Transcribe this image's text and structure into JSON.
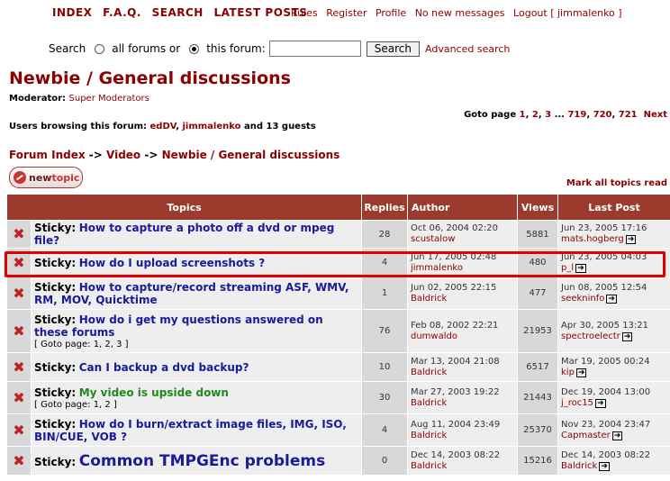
{
  "nav": {
    "main": [
      "INDEX",
      "F.A.Q.",
      "SEARCH",
      "LATEST POSTS"
    ],
    "secondary": [
      "Rules",
      "Register",
      "Profile",
      "No new messages",
      "Logout [ jimmalenko ]"
    ]
  },
  "search": {
    "label": "Search",
    "opt_all": "all forums or",
    "opt_this": "this forum:",
    "button": "Search",
    "advanced": "Advanced search",
    "value": ""
  },
  "forum": {
    "title": "Newbie / General discussions",
    "moderator_label": "Moderator:",
    "moderator": "Super Moderators",
    "browsing_label": "Users browsing this forum:",
    "browsing_user1": "edDV",
    "browsing_user2": "jimmalenko",
    "browsing_rest": "and 13 guests",
    "goto_label": "Goto page",
    "pages": [
      "1",
      "2",
      "3",
      "...",
      "719",
      "720",
      "721",
      "Next"
    ]
  },
  "breadcrumb": {
    "index": "Forum Index",
    "sep": "->",
    "video": "Video",
    "current": "Newbie / General discussions"
  },
  "buttons": {
    "newtopic_a": "new",
    "newtopic_b": "topic",
    "markall": "Mark all topics read"
  },
  "table": {
    "headers": [
      "Topics",
      "Replies",
      "Author",
      "Views",
      "Last Post"
    ],
    "rows": [
      {
        "prefix": "Sticky:",
        "title": "How to capture a photo off a dvd or mpeg file?",
        "goto": "",
        "replies": "28",
        "author_date": "Oct 06, 2004 02:20",
        "author": "scustalow",
        "views": "5881",
        "last_date": "Jun 23, 2005 17:16",
        "last_user": "mats.hogberg"
      },
      {
        "prefix": "Sticky:",
        "title": "How do I upload screenshots ?",
        "goto": "",
        "replies": "4",
        "author_date": "Jun 17, 2005 02:48",
        "author": "jimmalenko",
        "views": "480",
        "last_date": "Jun 23, 2005 04:03",
        "last_user": "p_l"
      },
      {
        "prefix": "Sticky:",
        "title": "How to capture/record streaming ASF, WMV, RM, MOV, Quicktime",
        "goto": "",
        "replies": "1",
        "author_date": "Jun 02, 2005 22:15",
        "author": "Baldrick",
        "views": "477",
        "last_date": "Jun 08, 2005 12:54",
        "last_user": "seekninfo"
      },
      {
        "prefix": "Sticky:",
        "title": "How do i get my questions answered on these forums",
        "goto": "[ Goto page: 1, 2, 3 ]",
        "replies": "76",
        "author_date": "Feb 08, 2002 22:21",
        "author": "dumwaldo",
        "views": "21953",
        "last_date": "Apr 30, 2005 13:21",
        "last_user": "spectroelectr"
      },
      {
        "prefix": "Sticky:",
        "title": "Can I backup a dvd backup?",
        "goto": "",
        "replies": "10",
        "author_date": "Mar 13, 2004 21:08",
        "author": "Baldrick",
        "views": "6517",
        "last_date": "Mar 19, 2005 00:24",
        "last_user": "kip"
      },
      {
        "prefix": "Sticky:",
        "title": "My video is upside down",
        "goto": "[ Goto page: 1, 2 ]",
        "replies": "30",
        "author_date": "Mar 27, 2003 19:22",
        "author": "Baldrick",
        "views": "21443",
        "last_date": "Dec 19, 2004 13:00",
        "last_user": "j_roc15"
      },
      {
        "prefix": "Sticky:",
        "title": "How do I burn/extract image files, IMG, ISO, BIN/CUE, VOB ?",
        "goto": "",
        "replies": "4",
        "author_date": "Aug 11, 2004 23:49",
        "author": "Baldrick",
        "views": "25370",
        "last_date": "Nov 23, 2004 23:47",
        "last_user": "Capmaster"
      },
      {
        "prefix": "Sticky:",
        "title": "Common TMPGEnc problems",
        "goto": "",
        "replies": "0",
        "author_date": "Dec 14, 2003 08:22",
        "author": "Baldrick",
        "views": "15216",
        "last_date": "Dec 14, 2003 08:22",
        "last_user": "Baldrick"
      }
    ]
  },
  "colors": {
    "accent": "#8b0000",
    "header_bg": "#9b3b2e",
    "link_blue": "#1a1a9a",
    "link_green": "#1f8a1f",
    "highlight": "#e00000"
  }
}
